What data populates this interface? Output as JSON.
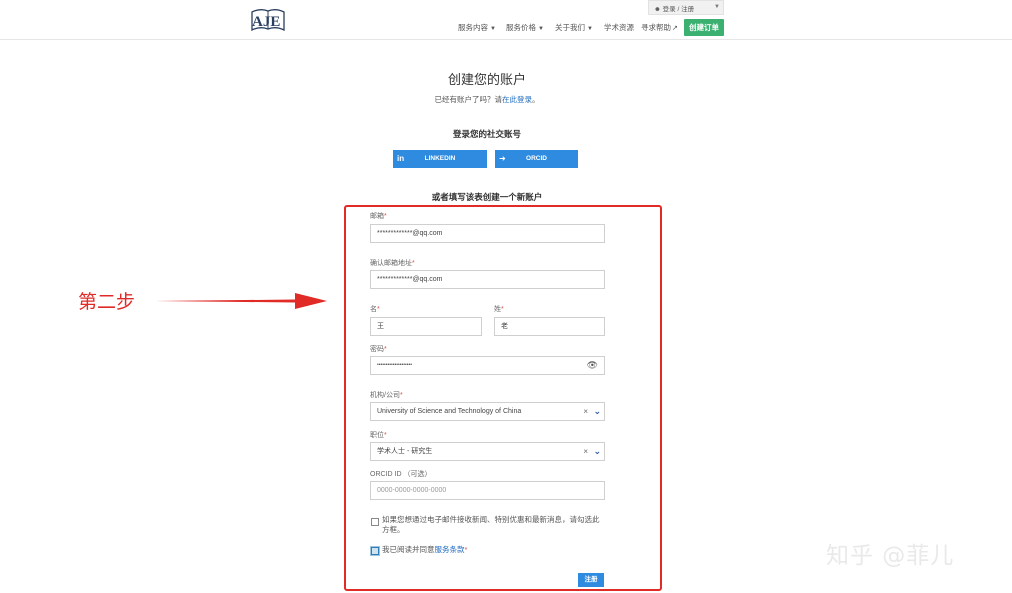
{
  "header": {
    "logo_text": "AJE",
    "login_text": "登录 / 注册",
    "nav": {
      "services": "服务内容",
      "pricing": "服务价格",
      "about": "关于我们",
      "resources": "学术资源",
      "help": "寻求帮助"
    },
    "order_button": "创建订单"
  },
  "page": {
    "title": "创建您的账户",
    "subtitle_prefix": "已经有账户了吗？请",
    "subtitle_link": "在此登录",
    "subtitle_suffix": "。",
    "social_title": "登录您的社交账号",
    "linkedin_label": "LINKEDIN",
    "orcid_label": "ORCID",
    "or_title": "或者填写该表创建一个新账户"
  },
  "form": {
    "required_mark": "*",
    "email_label": "邮箱",
    "email_value": "*************@qq.com",
    "confirm_email_label": "确认邮箱地址",
    "confirm_email_value": "*************@qq.com",
    "first_name_label": "名",
    "first_name_value": "王",
    "last_name_label": "姓",
    "last_name_value": "老",
    "password_label": "密码",
    "password_value": "••••••••••••••••••••",
    "org_label": "机构/公司",
    "org_value": "University of Science and Technology of China",
    "position_label": "职位",
    "position_value": "学术人士 - 研究生",
    "orcid_label": "ORCID ID （可选）",
    "orcid_placeholder": "0000-0000-0000-0000",
    "newsletter_text_line1": "如果您想通过电子邮件接收新闻、特别优惠和最新消息，请勾选此",
    "newsletter_text_line2": "方框。",
    "newsletter_checked": false,
    "terms_prefix": "我已阅读并同意",
    "terms_link": "服务条款",
    "terms_checked": true,
    "register_button": "注册"
  },
  "annotation": {
    "step_label": "第二步"
  },
  "watermark": "知乎 @菲儿",
  "colors": {
    "accent_blue": "#2e8be0",
    "order_green": "#3cb070",
    "annotation_red": "#e02b27",
    "link_blue": "#1f6bbf"
  },
  "icons": {
    "linkedin": "linkedin-icon",
    "orcid": "login-icon",
    "password_toggle": "eye-icon",
    "dropdown": "chevron-down-icon",
    "clear": "close-icon",
    "external": "external-link-icon"
  }
}
